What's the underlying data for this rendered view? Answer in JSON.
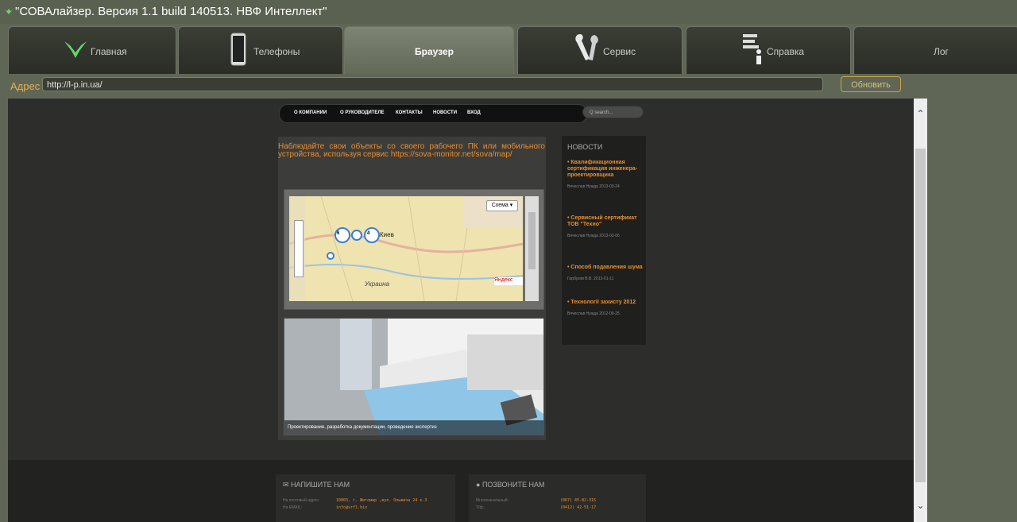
{
  "window": {
    "title": "\"СОВАлайзер. Версия 1.1 build 140513. НВФ Интеллект\""
  },
  "tabs": [
    {
      "label": "Главная"
    },
    {
      "label": "Телефоны"
    },
    {
      "label": "Браузер"
    },
    {
      "label": "Сервис"
    },
    {
      "label": "Справка"
    },
    {
      "label": "Лог"
    }
  ],
  "address_bar": {
    "label": "Адрес",
    "url": "http://l-p.in.ua/",
    "refresh_label": "Обновить"
  },
  "web_page": {
    "nav": [
      "О КОМПАНИИ",
      "О РУКОВОДИТЕЛЕ",
      "КОНТАКТЫ",
      "НОВОСТИ",
      "ВХОД"
    ],
    "search_placeholder": "Q search...",
    "promo_text": "Наблюдайте свои объекты со своего рабочего ПК или мобильного устройства, используя сервис https://sova-monitor.net/sova/map/",
    "map": {
      "scheme_label": "Схема",
      "city_label": "Киев",
      "region_label": "Украина",
      "yandex_label": "Яндекс",
      "marker_counts": [
        "6",
        "4"
      ]
    },
    "photo_caption": "Проектирование, разработка документации, проведение экспертиз",
    "news": {
      "heading": "НОВОСТИ",
      "items": [
        {
          "title": "Квалификационная сертификация инженера-проектировщика",
          "meta": "Вячеслав Нужда 2013-03-24"
        },
        {
          "title": "Сервисный сертификат ТОВ \"Техно\"",
          "meta": "Вячеслав Нужда 2013-03-06"
        },
        {
          "title": "Способ подавления шума",
          "meta": "Гарбузов В.В. 2013-01-11"
        },
        {
          "title": "Технології захисту 2012",
          "meta": "Вячеслав Нужда 2012-09-25"
        }
      ]
    },
    "footer": {
      "write": {
        "heading": "НАПИШИТЕ НАМ",
        "rows": [
          {
            "k": "На почтовый адрес:",
            "v": "10003, г. Житомир ,вул. Ольжича 24 к.3"
          },
          {
            "k": "На EMAIL:",
            "v": "info@srfl.biz"
          }
        ]
      },
      "call": {
        "heading": "ПОЗВОНИТЕ НАМ",
        "rows": [
          {
            "k": "Многоканальный:",
            "v": "(067) 45-82-315"
          },
          {
            "k": "Т/ф.:",
            "v": "(0412) 42-51-17"
          }
        ]
      }
    }
  },
  "colors": {
    "accent_orange": "#ec8e2e",
    "chrome": "#5f6655",
    "page_bg": "#2d2d2b"
  }
}
